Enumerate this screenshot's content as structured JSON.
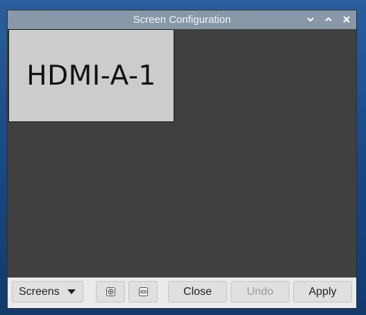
{
  "window": {
    "title": "Screen Configuration",
    "controls": {
      "minimize_icon": "chevron-down-icon",
      "maximize_icon": "chevron-up-icon",
      "close_icon": "close-icon"
    }
  },
  "canvas": {
    "monitors": [
      {
        "label": "HDMI-A-1"
      }
    ]
  },
  "toolbar": {
    "screens_label": "Screens",
    "zoom_in_icon": "zoom-in-icon",
    "zoom_out_icon": "zoom-out-icon",
    "close_label": "Close",
    "undo_label": "Undo",
    "apply_label": "Apply",
    "undo_disabled": true
  },
  "colors": {
    "titlebar": "#8898a8",
    "canvas": "#404040",
    "monitor": "#cccccc",
    "toolbar": "#ebebeb"
  }
}
